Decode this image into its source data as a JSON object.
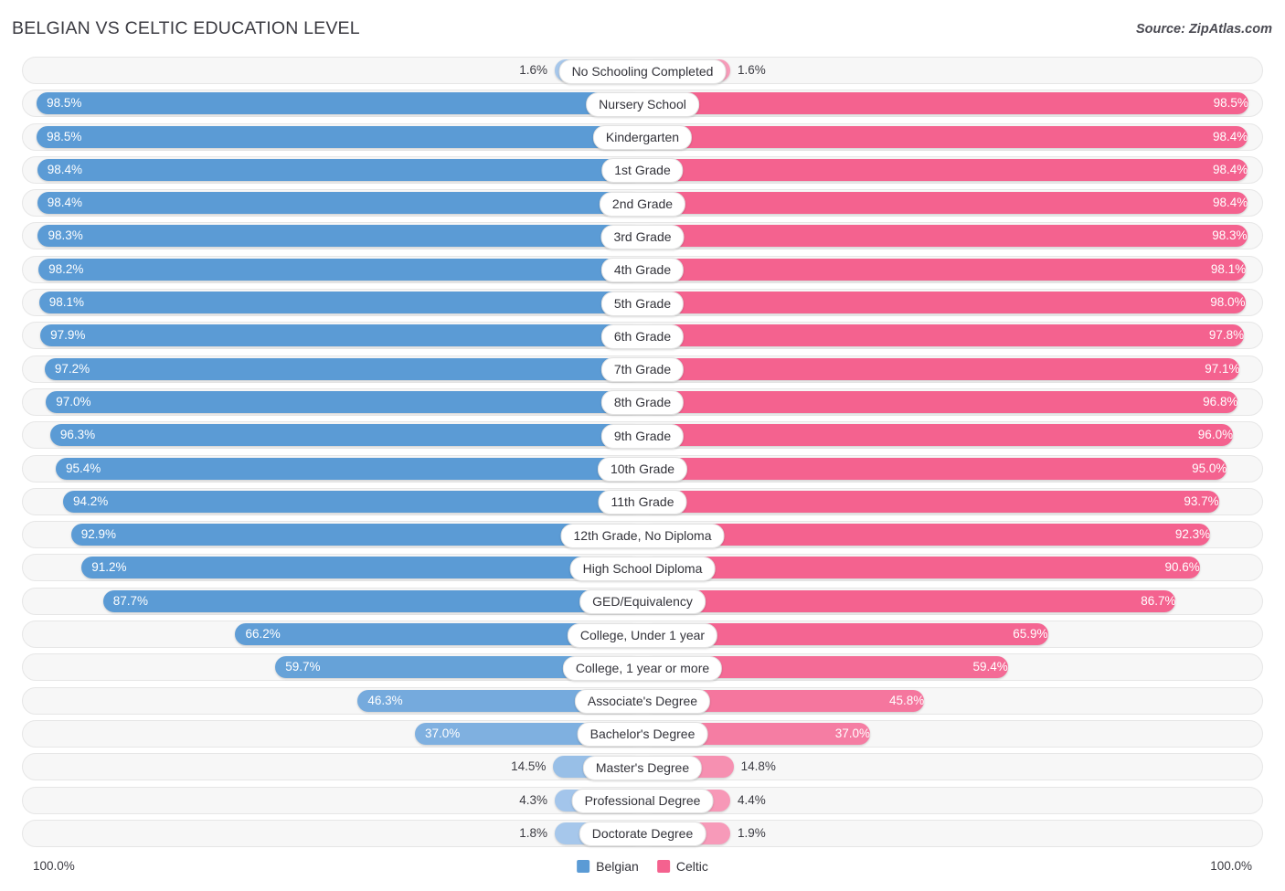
{
  "header": {
    "title": "BELGIAN VS CELTIC EDUCATION LEVEL",
    "source": "Source: ZipAtlas.com"
  },
  "footer": {
    "axis_left": "100.0%",
    "axis_right": "100.0%",
    "legend": [
      {
        "label": "Belgian",
        "color": "#5b9bd5"
      },
      {
        "label": "Celtic",
        "color": "#f4628f"
      }
    ]
  },
  "colors": {
    "belgian_strong": "#5b9bd5",
    "belgian_light": "#a8c8ec",
    "celtic_strong": "#f4628f",
    "celtic_light": "#f79cba",
    "track": "#f7f7f7",
    "track_border": "#e6e6e6"
  },
  "chart_data": {
    "type": "bar",
    "subtype": "diverging-bidirectional",
    "title": "BELGIAN VS CELTIC EDUCATION LEVEL",
    "xlabel": "",
    "ylabel": "",
    "xlim": [
      0,
      100
    ],
    "grid": false,
    "legend_position": "bottom-center",
    "axis_tick_labels": [
      "100.0%",
      "100.0%"
    ],
    "categories": [
      "No Schooling Completed",
      "Nursery School",
      "Kindergarten",
      "1st Grade",
      "2nd Grade",
      "3rd Grade",
      "4th Grade",
      "5th Grade",
      "6th Grade",
      "7th Grade",
      "8th Grade",
      "9th Grade",
      "10th Grade",
      "11th Grade",
      "12th Grade, No Diploma",
      "High School Diploma",
      "GED/Equivalency",
      "College, Under 1 year",
      "College, 1 year or more",
      "Associate's Degree",
      "Bachelor's Degree",
      "Master's Degree",
      "Professional Degree",
      "Doctorate Degree"
    ],
    "series": [
      {
        "name": "Belgian",
        "color": "#5b9bd5",
        "side": "left",
        "values": [
          1.6,
          98.5,
          98.5,
          98.4,
          98.4,
          98.3,
          98.2,
          98.1,
          97.9,
          97.2,
          97.0,
          96.3,
          95.4,
          94.2,
          92.9,
          91.2,
          87.7,
          66.2,
          59.7,
          46.3,
          37.0,
          14.5,
          4.3,
          1.8
        ],
        "labels": [
          "1.6%",
          "98.5%",
          "98.5%",
          "98.4%",
          "98.4%",
          "98.3%",
          "98.2%",
          "98.1%",
          "97.9%",
          "97.2%",
          "97.0%",
          "96.3%",
          "95.4%",
          "94.2%",
          "92.9%",
          "91.2%",
          "87.7%",
          "66.2%",
          "59.7%",
          "46.3%",
          "37.0%",
          "14.5%",
          "4.3%",
          "1.8%"
        ]
      },
      {
        "name": "Celtic",
        "color": "#f4628f",
        "side": "right",
        "values": [
          1.6,
          98.5,
          98.4,
          98.4,
          98.4,
          98.3,
          98.1,
          98.0,
          97.8,
          97.1,
          96.8,
          96.0,
          95.0,
          93.7,
          92.3,
          90.6,
          86.7,
          65.9,
          59.4,
          45.8,
          37.0,
          14.8,
          4.4,
          1.9
        ],
        "labels": [
          "1.6%",
          "98.5%",
          "98.4%",
          "98.4%",
          "98.4%",
          "98.3%",
          "98.1%",
          "98.0%",
          "97.8%",
          "97.1%",
          "96.8%",
          "96.0%",
          "95.0%",
          "93.7%",
          "92.3%",
          "90.6%",
          "86.7%",
          "65.9%",
          "59.4%",
          "45.8%",
          "37.0%",
          "14.8%",
          "4.4%",
          "1.9%"
        ]
      }
    ]
  }
}
